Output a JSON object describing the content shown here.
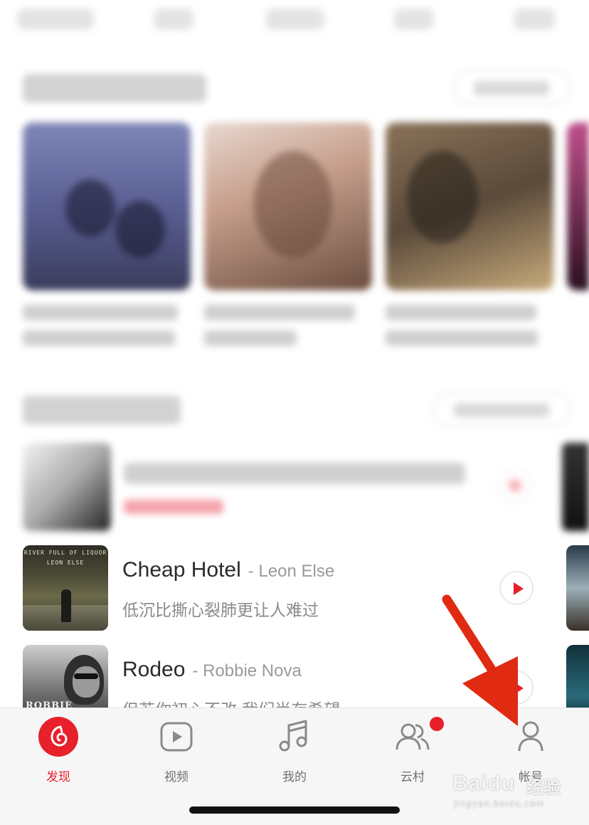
{
  "songs": [
    {
      "title": "Cheap Hotel",
      "artist": "- Leon Else",
      "subtitle": "低沉比撕心裂肺更让人难过",
      "cover_text_line1": "RIVER FULL OF LIQUOR",
      "cover_text_line2": "LEON ELSE"
    },
    {
      "title": "Rodeo",
      "artist": "- Robbie Nova",
      "subtitle": "但若你初心不改 我们尚存希望",
      "cover_text_line1": "ROBBIE"
    }
  ],
  "tabbar": {
    "tabs": [
      {
        "label": "发现",
        "icon": "netease-music-logo-icon",
        "active": true
      },
      {
        "label": "视频",
        "icon": "video-play-icon",
        "active": false
      },
      {
        "label": "我的",
        "icon": "music-note-icon",
        "active": false
      },
      {
        "label": "云村",
        "icon": "people-icon",
        "active": false,
        "badge": true
      },
      {
        "label": "帐号",
        "icon": "user-icon",
        "active": false
      }
    ]
  },
  "watermark": {
    "logo": "Baidu",
    "text": "经验",
    "url": "jingyan.baidu.com"
  },
  "colors": {
    "accent": "#e8202a",
    "tabbar_bg": "#f6f6f6",
    "annotation_arrow": "#e02a12"
  }
}
